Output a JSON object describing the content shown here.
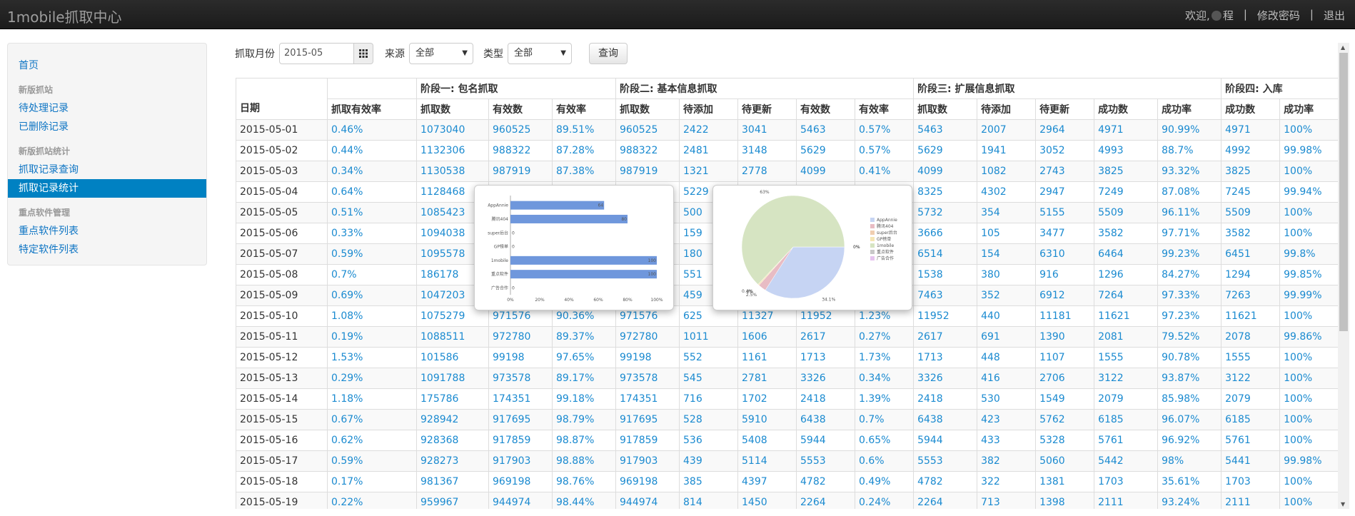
{
  "navbar": {
    "brand": "1mobile抓取中心",
    "welcome": "欢迎,",
    "user_suffix": "程",
    "sep": "|",
    "change_password": "修改密码",
    "logout": "退出"
  },
  "sidebar": {
    "home": "首页",
    "groups": [
      {
        "header": "新版抓站",
        "items": [
          "待处理记录",
          "已删除记录"
        ]
      },
      {
        "header": "新版抓站统计",
        "items": [
          "抓取记录查询",
          "抓取记录统计"
        ]
      },
      {
        "header": "重点软件管理",
        "items": [
          "重点软件列表",
          "特定软件列表"
        ]
      }
    ],
    "active_item": "抓取记录统计"
  },
  "filters": {
    "month_label": "抓取月份",
    "month_value": "2015-05",
    "source_label": "来源",
    "source_value": "全部",
    "type_label": "类型",
    "type_value": "全部",
    "query_button": "查询"
  },
  "table": {
    "group_headers": [
      "",
      "",
      "阶段一: 包名抓取",
      "阶段二: 基本信息抓取",
      "阶段三: 扩展信息抓取",
      "阶段四: 入库"
    ],
    "columns": [
      "日期",
      "抓取有效率",
      "抓取数",
      "有效数",
      "有效率",
      "抓取数",
      "待添加",
      "待更新",
      "有效数",
      "有效率",
      "抓取数",
      "待添加",
      "待更新",
      "成功数",
      "成功率",
      "成功数",
      "成功率"
    ],
    "rows": [
      [
        "2015-05-01",
        "0.46%",
        "1073040",
        "960525",
        "89.51%",
        "960525",
        "2422",
        "3041",
        "5463",
        "0.57%",
        "5463",
        "2007",
        "2964",
        "4971",
        "90.99%",
        "4971",
        "100%"
      ],
      [
        "2015-05-02",
        "0.44%",
        "1132306",
        "988322",
        "87.28%",
        "988322",
        "2481",
        "3148",
        "5629",
        "0.57%",
        "5629",
        "1941",
        "3052",
        "4993",
        "88.7%",
        "4992",
        "99.98%"
      ],
      [
        "2015-05-03",
        "0.34%",
        "1130538",
        "987919",
        "87.38%",
        "987919",
        "1321",
        "2778",
        "4099",
        "0.41%",
        "4099",
        "1082",
        "2743",
        "3825",
        "93.32%",
        "3825",
        "100%"
      ],
      [
        "2015-05-04",
        "0.64%",
        "1128468",
        "",
        "",
        "",
        "5229",
        "",
        "",
        "",
        "8325",
        "4302",
        "2947",
        "7249",
        "87.08%",
        "7245",
        "99.94%"
      ],
      [
        "2015-05-05",
        "0.51%",
        "1085423",
        "",
        "",
        "",
        "500",
        "",
        "",
        "",
        "5732",
        "354",
        "5155",
        "5509",
        "96.11%",
        "5509",
        "100%"
      ],
      [
        "2015-05-06",
        "0.33%",
        "1094038",
        "",
        "",
        "",
        "159",
        "",
        "",
        "",
        "3666",
        "105",
        "3477",
        "3582",
        "97.71%",
        "3582",
        "100%"
      ],
      [
        "2015-05-07",
        "0.59%",
        "1095578",
        "",
        "",
        "",
        "180",
        "",
        "",
        "",
        "6514",
        "154",
        "6310",
        "6464",
        "99.23%",
        "6451",
        "99.8%"
      ],
      [
        "2015-05-08",
        "0.7%",
        "186178",
        "",
        "",
        "",
        "551",
        "",
        "",
        "",
        "1538",
        "380",
        "916",
        "1296",
        "84.27%",
        "1294",
        "99.85%"
      ],
      [
        "2015-05-09",
        "0.69%",
        "1047203",
        "",
        "",
        "",
        "459",
        "",
        "",
        "",
        "7463",
        "352",
        "6912",
        "7264",
        "97.33%",
        "7263",
        "99.99%"
      ],
      [
        "2015-05-10",
        "1.08%",
        "1075279",
        "971576",
        "90.36%",
        "971576",
        "625",
        "11327",
        "11952",
        "1.23%",
        "11952",
        "440",
        "11181",
        "11621",
        "97.23%",
        "11621",
        "100%"
      ],
      [
        "2015-05-11",
        "0.19%",
        "1088511",
        "972780",
        "89.37%",
        "972780",
        "1011",
        "1606",
        "2617",
        "0.27%",
        "2617",
        "691",
        "1390",
        "2081",
        "79.52%",
        "2078",
        "99.86%"
      ],
      [
        "2015-05-12",
        "1.53%",
        "101586",
        "99198",
        "97.65%",
        "99198",
        "552",
        "1161",
        "1713",
        "1.73%",
        "1713",
        "448",
        "1107",
        "1555",
        "90.78%",
        "1555",
        "100%"
      ],
      [
        "2015-05-13",
        "0.29%",
        "1091788",
        "973578",
        "89.17%",
        "973578",
        "545",
        "2781",
        "3326",
        "0.34%",
        "3326",
        "416",
        "2706",
        "3122",
        "93.87%",
        "3122",
        "100%"
      ],
      [
        "2015-05-14",
        "1.18%",
        "175786",
        "174351",
        "99.18%",
        "174351",
        "716",
        "1702",
        "2418",
        "1.39%",
        "2418",
        "530",
        "1549",
        "2079",
        "85.98%",
        "2079",
        "100%"
      ],
      [
        "2015-05-15",
        "0.67%",
        "928942",
        "917695",
        "98.79%",
        "917695",
        "528",
        "5910",
        "6438",
        "0.7%",
        "6438",
        "423",
        "5762",
        "6185",
        "96.07%",
        "6185",
        "100%"
      ],
      [
        "2015-05-16",
        "0.62%",
        "928368",
        "917859",
        "98.87%",
        "917859",
        "536",
        "5408",
        "5944",
        "0.65%",
        "5944",
        "433",
        "5328",
        "5761",
        "96.92%",
        "5761",
        "100%"
      ],
      [
        "2015-05-17",
        "0.59%",
        "928273",
        "917903",
        "98.88%",
        "917903",
        "439",
        "5114",
        "5553",
        "0.6%",
        "5553",
        "382",
        "5060",
        "5442",
        "98%",
        "5441",
        "99.98%"
      ],
      [
        "2015-05-18",
        "0.17%",
        "981367",
        "969198",
        "98.76%",
        "969198",
        "385",
        "4397",
        "4782",
        "0.49%",
        "4782",
        "322",
        "1381",
        "1703",
        "35.61%",
        "1703",
        "100%"
      ],
      [
        "2015-05-19",
        "0.22%",
        "959967",
        "944974",
        "98.44%",
        "944974",
        "814",
        "1450",
        "2264",
        "0.24%",
        "2264",
        "713",
        "1398",
        "2111",
        "93.24%",
        "2111",
        "100%"
      ]
    ]
  },
  "chart_data": [
    {
      "type": "bar",
      "orientation": "horizontal",
      "categories": [
        "AppAnnie",
        "腾讯404",
        "super后台",
        "GP榜单",
        "1mobile",
        "重点软件",
        "广告合作"
      ],
      "values": [
        64,
        80,
        0,
        0,
        100,
        100,
        0
      ],
      "x_ticks": [
        "0%",
        "20%",
        "40%",
        "60%",
        "80%",
        "100%"
      ],
      "xlim": [
        0,
        100
      ],
      "color": "#6f97dc"
    },
    {
      "type": "pie",
      "labels": [
        "AppAnnie",
        "腾讯404",
        "super后台",
        "GP榜单",
        "1mobile",
        "重点软件",
        "广告合作"
      ],
      "values": [
        34.1,
        2.5,
        0,
        0.4,
        63,
        0,
        0
      ],
      "slice_labels": [
        "34.1%",
        "2.5%",
        "0%",
        "0.4%",
        "63%",
        "0%",
        "0%"
      ],
      "colors": [
        "#c6d4f3",
        "#e8bcc4",
        "#f0ceb0",
        "#f5e6b5",
        "#d6e4c2",
        "#c8c8c8",
        "#e6c4ef"
      ],
      "legend_position": "right"
    }
  ]
}
